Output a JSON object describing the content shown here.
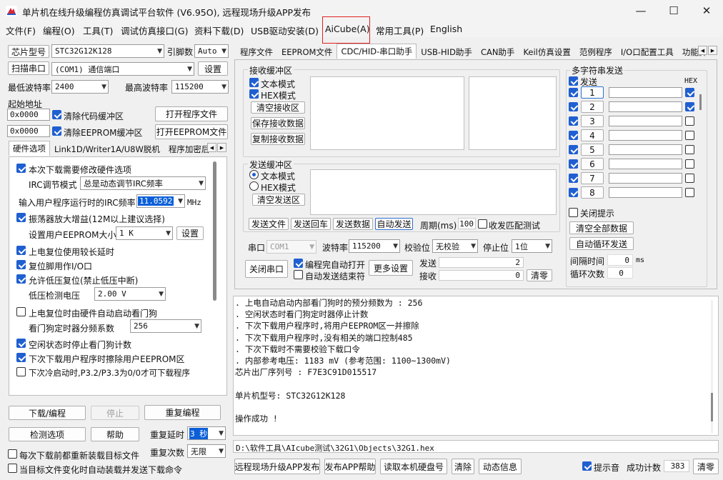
{
  "window": {
    "title": "单片机在线升级编程仿真调试平台软件 (V6.95O), 远程现场升级APP发布",
    "minimize": "—",
    "maximize": "☐",
    "close": "✕"
  },
  "menu": [
    "文件(F)",
    "编程(O)",
    "工具(T)",
    "调试仿真接口(G)",
    "资料下载(D)",
    "USB驱动安装(D)",
    "AiCube(A)",
    "常用工具(P)",
    "English"
  ],
  "left": {
    "chip_btn": "芯片型号",
    "chip_value": "STC32G12K128",
    "pins_label": "引脚数",
    "pins_value": "Auto",
    "scan_btn": "扫描串口",
    "port_value": "(COM1) 通信端口",
    "settings_btn": "设置",
    "min_baud_label": "最低波特率",
    "min_baud_value": "2400",
    "max_baud_label": "最高波特率",
    "max_baud_value": "115200",
    "start_addr_label": "起始地址",
    "addr1": "0x0000",
    "clear_code": "清除代码缓冲区",
    "open_prog": "打开程序文件",
    "addr2": "0x0000",
    "clear_eeprom": "清除EEPROM缓冲区",
    "open_eeprom": "打开EEPROM文件",
    "tabs": [
      "硬件选项",
      "Link1D/Writer1A/U8W脱机",
      "程序加密后"
    ],
    "hw": {
      "opt_modify": "本次下载需要修改硬件选项",
      "irc_mode_label": "IRC调节模式",
      "irc_mode_value": "总是动态调节IRC频率",
      "irc_freq_label": "输入用户程序运行时的IRC频率",
      "irc_freq_value": "11.0592",
      "irc_unit": "MHz",
      "osc_gain": "振荡器放大增益(12M以上建议选择)",
      "eeprom_size_label": "设置用户EEPROM大小",
      "eeprom_size_value": "1  K",
      "eeprom_btn": "设置",
      "long_reset": "上电复位使用较长延时",
      "reset_io": "复位脚用作I/O口",
      "lvr": "允许低压复位(禁止低压中断)",
      "lvr_label": "低压检测电压",
      "lvr_value": "2.00 V",
      "wdt_auto": "上电复位时由硬件自动启动看门狗",
      "wdt_div_label": "看门狗定时器分频系数",
      "wdt_div_value": "256",
      "idle_wdt": "空闲状态时停止看门狗计数",
      "erase_eeprom": "下次下载用户程序时擦除用户EEPROM区",
      "p32_p33": "下次冷启动时,P3.2/P3.3为0/0才可下载程序"
    },
    "download_btn": "下载/编程",
    "stop_btn": "停止",
    "reprog_btn": "重复编程",
    "check_btn": "检测选项",
    "help_btn": "帮助",
    "repeat_delay_label": "重复延时",
    "repeat_delay_value": "3 秒",
    "repeat_count_label": "重复次数",
    "repeat_count_value": "无限",
    "reload_each": "每次下载前都重新装载目标文件",
    "auto_reload": "当目标文件变化时自动装载并发送下载命令"
  },
  "right": {
    "tabs": [
      "程序文件",
      "EEPROM文件",
      "CDC/HID-串口助手",
      "USB-HID助手",
      "CAN助手",
      "Keil仿真设置",
      "范例程序",
      "I/O口配置工具",
      "功能脚"
    ],
    "recv": {
      "title": "接收缓冲区",
      "text_mode": "文本模式",
      "hex_mode": "HEX模式",
      "clear": "清空接收区",
      "save": "保存接收数据",
      "copy": "复制接收数据"
    },
    "send": {
      "title": "发送缓冲区",
      "text_mode": "文本模式",
      "hex_mode": "HEX模式",
      "clear": "清空发送区",
      "send_file": "发送文件",
      "send_return": "发送回车",
      "send_data": "发送数据",
      "auto_send": "自动发送",
      "period_label": "周期(ms)",
      "period_value": "100",
      "match_test": "收发匹配测试"
    },
    "multi": {
      "title": "多字符串发送",
      "send_label": "发送",
      "hex_label": "HEX",
      "rows": [
        "1",
        "2",
        "3",
        "4",
        "5",
        "6",
        "7",
        "8"
      ],
      "close_hint": "关闭提示",
      "clear_all": "清空全部数据",
      "auto_loop": "自动循环发送",
      "interval_label": "间隔时间",
      "interval_value": "0",
      "interval_unit": "ms",
      "loop_label": "循环次数",
      "loop_value": "0"
    },
    "port_label": "串口",
    "port_value": "COM1",
    "baud_label": "波特率",
    "baud_value": "115200",
    "parity_label": "校验位",
    "parity_value": "无校验",
    "stop_label": "停止位",
    "stop_value": "1位",
    "close_port": "关闭串口",
    "auto_open": "编程完自动打开",
    "auto_end": "自动发送结束符",
    "more_settings": "更多设置",
    "send_count_label": "发送",
    "send_count": "2",
    "recv_count_label": "接收",
    "recv_count": "0",
    "clear_count": "清零"
  },
  "log": {
    "lines": [
      "  . 上电自动启动内部看门狗时的预分频数为 : 256",
      "  . 空闲状态时看门狗定时器停止计数",
      "  . 下次下载用户程序时,将用户EEPROM区一并擦除",
      "  . 下次下载用户程序时,没有相关的端口控制485",
      "  . 下次下载时不需要校验下载口令",
      "  . 内部参考电压: 1183 mV (参考范围: 1100~1300mV)",
      "芯片出厂序列号 : F7E3C91D015517",
      "",
      "  单片机型号: STC32G12K128",
      "",
      "操作成功 !"
    ]
  },
  "path": "D:\\软件工具\\AIcube测试\\32G1\\Objects\\32G1.hex",
  "bottom": {
    "remote_app": "远程现场升级APP发布",
    "publish_help": "发布APP帮助",
    "read_disk": "读取本机硬盘号",
    "clear": "清除",
    "animation": "动态信息",
    "sound": "提示音",
    "success_label": "成功计数",
    "success_value": "383",
    "zero": "清零"
  },
  "colors": {
    "highlight_box": "#e02020",
    "checkbox_blue": "#1f5fd1",
    "selection": "#0a5fd8"
  }
}
